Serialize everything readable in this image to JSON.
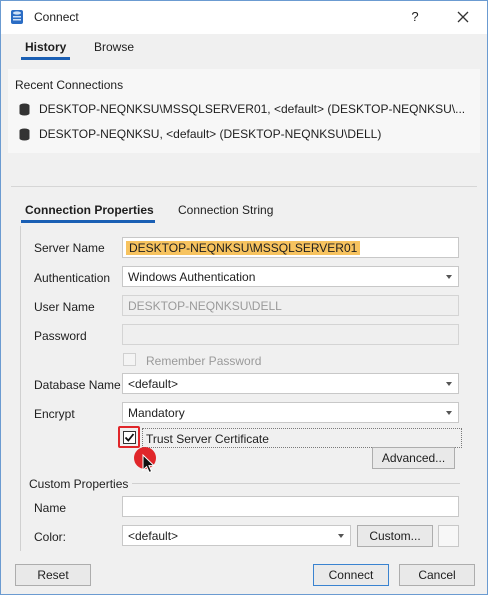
{
  "window": {
    "title": "Connect",
    "help": "?"
  },
  "top_tabs": [
    {
      "label": "History"
    },
    {
      "label": "Browse"
    }
  ],
  "recent": {
    "title": "Recent Connections",
    "items": [
      {
        "text": "DESKTOP-NEQNKSU\\MSSQLSERVER01, <default> (DESKTOP-NEQNKSU\\..."
      },
      {
        "text": "DESKTOP-NEQNKSU, <default> (DESKTOP-NEQNKSU\\DELL)"
      }
    ]
  },
  "prop_tabs": [
    {
      "label": "Connection Properties"
    },
    {
      "label": "Connection String"
    }
  ],
  "form": {
    "server_name_label": "Server Name",
    "server_name_value": "DESKTOP-NEQNKSU\\MSSQLSERVER01",
    "auth_label": "Authentication",
    "auth_value": "Windows Authentication",
    "user_label": "User Name",
    "user_value": "DESKTOP-NEQNKSU\\DELL",
    "password_label": "Password",
    "password_value": "",
    "remember_label": "Remember Password",
    "db_label": "Database Name",
    "db_value": "<default>",
    "encrypt_label": "Encrypt",
    "encrypt_value": "Mandatory",
    "trust_label": "Trust Server Certificate",
    "advanced_label": "Advanced..."
  },
  "custom": {
    "title": "Custom Properties",
    "name_label": "Name",
    "name_value": "",
    "color_label": "Color:",
    "color_value": "<default>",
    "custom_button": "Custom..."
  },
  "footer": {
    "reset": "Reset",
    "connect": "Connect",
    "cancel": "Cancel"
  },
  "colors": {
    "accent": "#1a5fb4",
    "highlight": "#f7c35f",
    "callout": "#e0262a"
  },
  "icons": {
    "app": "database-app-icon",
    "db": "database-icon",
    "close": "close-icon",
    "cursor": "mouse-pointer-icon"
  },
  "state": {
    "trust_checked": true,
    "remember_checked": false
  }
}
